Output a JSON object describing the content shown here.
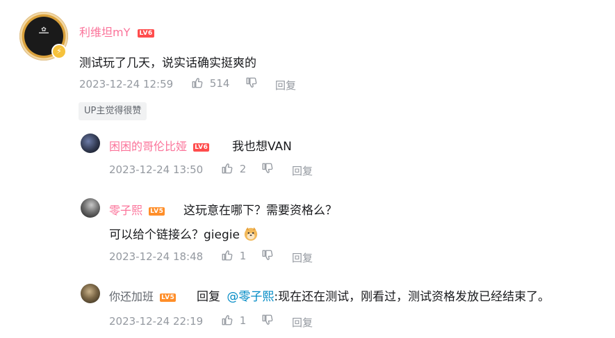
{
  "main_comment": {
    "username": "利维坦mY",
    "level": "LV6",
    "text": "测试玩了几天，说实话确实挺爽的",
    "time": "2023-12-24 12:59",
    "likes": "514",
    "reply_label": "回复",
    "up_tag": "UP主觉得很赞"
  },
  "replies": [
    {
      "username": "困困的哥伦比娅",
      "level": "LV6",
      "text": "我也想VAN",
      "time": "2023-12-24 13:50",
      "likes": "2",
      "reply_label": "回复"
    },
    {
      "username": "零子熙",
      "level": "LV5",
      "text_line1": "这玩意在哪下？需要资格么？",
      "text_line2": "可以给个链接么？giegie",
      "time": "2023-12-24 18:48",
      "likes": "1",
      "reply_label": "回复"
    },
    {
      "username": "你还加班",
      "level": "LV5",
      "reply_prefix": "回复",
      "mention": "@零子熙",
      "text": ":现在还在测试，刚看过，测试资格发放已经结束了。",
      "time": "2023-12-24 22:19",
      "likes": "1",
      "reply_label": "回复"
    }
  ],
  "icons": {
    "like": "thumbs-up-icon",
    "dislike": "thumbs-down-icon",
    "badge": "lightning-icon",
    "emoji": "doge-emoji"
  },
  "colors": {
    "vip_name": "#fb7299",
    "normal_name": "#61666d",
    "meta": "#9499a0",
    "link": "#008ac5",
    "lv6": "#ff4c4c",
    "lv5": "#ff8e29"
  }
}
